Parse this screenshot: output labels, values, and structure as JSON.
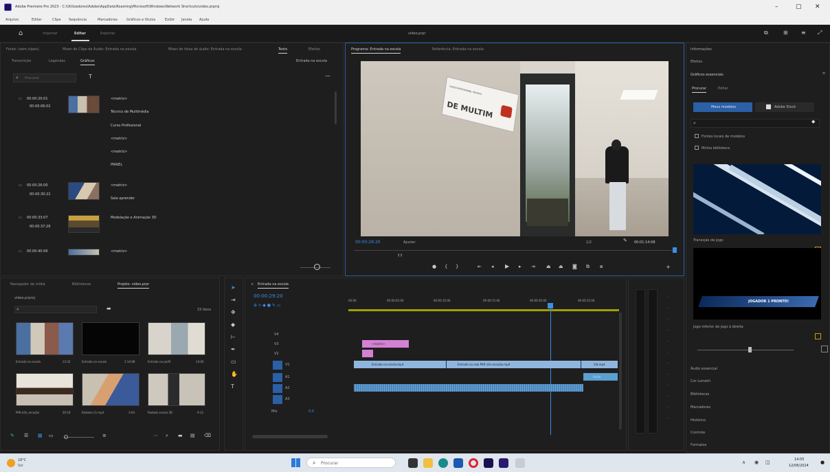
{
  "window": {
    "title": "Adobe Premiere Pro 2023 - C:\\Utilizadores\\Adobe\\AppData\\Roaming\\Microsoft\\Windows\\Network Shortcuts\\video.prproj",
    "controls": [
      "–",
      "▢",
      "✕"
    ]
  },
  "menu": [
    "Arquivo",
    "Editar",
    "Clipe",
    "Sequência",
    "Marcadores",
    "Gráficos e títulos",
    "Exibir",
    "Janela",
    "Ajuda"
  ],
  "header": {
    "tabs": [
      "Importar",
      "Editar",
      "Exportar"
    ],
    "active_tab": "Editar",
    "project_name": "video.prpr"
  },
  "source_panel": {
    "tabs": [
      "Fonte: (sem clipes)",
      "Mixer de Clipe de Áudio: Entrada na escola",
      "Mixer de faixa de áudio: Entrada na escola",
      "Texto",
      "Efeitos"
    ],
    "sub_tabs": [
      "Transcrição",
      "Legendas",
      "Gráficos"
    ],
    "active_sub_tab": "Gráficos",
    "search_placeholder": "Procurar",
    "sequence_label": "Entrada na escola",
    "items": [
      {
        "in": "00:00:20:01",
        "out": "00:00:06:02",
        "lines": [
          "<matriz>",
          "Técnico de Multimédia",
          "Curso Profissional",
          "<matriz>",
          "<matriz>",
          "PRAIEL"
        ]
      },
      {
        "in": "00:00:26:00",
        "out": "00:00:30:22",
        "lines": [
          "<matriz>",
          "Sala aprender"
        ]
      },
      {
        "in": "00:00:33:07",
        "out": "00:00:37:26",
        "lines": [
          "Modelação e Animação 3D"
        ]
      },
      {
        "in": "00:00:40:06",
        "out": "",
        "lines": [
          "<matriz>"
        ]
      }
    ]
  },
  "program_monitor": {
    "tabs": [
      "Programa: Entrada na escola",
      "Referência: Entrada na escola"
    ],
    "timecode": "00:00:29:20",
    "fit": "Ajustar",
    "quality": "1/2",
    "duration": "00:01:14:08",
    "sign_text": "DE MULTIM",
    "sign_small": "CURSO PROFISSIONAL TÉCNICO"
  },
  "right_panel": {
    "title": "Informações",
    "section1": "Efeitos",
    "section2": "Gráficos essenciais",
    "tabs": [
      "Procurar",
      "Editar"
    ],
    "active_tab": "Procurar",
    "buttons": [
      "Meus modelos",
      "Adobe Stock"
    ],
    "checkbox1": "Fontes locais de modelos",
    "checkbox2": "Minha biblioteca",
    "template1_label": "Transição de jogo",
    "template2_label": "Jogo inferior de jogo à direita",
    "template2_overlay": "JOGADOR 1 PRONTO!",
    "lower_items": [
      "Áudio essencial",
      "Cor Lumetri",
      "Bibliotecas",
      "Marcadores",
      "Histórico",
      "Controle",
      "Formatos"
    ]
  },
  "project_panel": {
    "tabs": [
      "Navegador de mídia",
      "Bibliotecas",
      "Projeto: video.prpr"
    ],
    "path": "video.prproj",
    "items_count": "15 itens",
    "thumbs": [
      {
        "name": "Entrada na escola",
        "dur": "13:32"
      },
      {
        "name": "Entrada na escola",
        "dur": "1:14:08"
      },
      {
        "name": "Entrada no perfil",
        "dur": "14:00"
      },
      {
        "name": "PAR.Info_receção",
        "dur": "20:16"
      },
      {
        "name": "Rodado (1).mp4",
        "dur": "3:04"
      },
      {
        "name": "Rodado escola 3D",
        "dur": "9:12"
      }
    ]
  },
  "timeline": {
    "tab": "Entrada na escola",
    "timecode": "00:00:29:20",
    "ruler": [
      "00:00",
      "00:00:05:00",
      "00:00:10:00",
      "00:00:15:00",
      "00:00:20:00",
      "00:00:25:00"
    ],
    "tracks": [
      "V4",
      "V3",
      "V2",
      "V1",
      "A1",
      "A2",
      "A3",
      "Mix"
    ],
    "clips": {
      "v3": "<matriz>",
      "v1_a": "Entrada na escola.mp4",
      "v1_b": "Entrada na sala PAR info receção.mp4",
      "v1_c": "Vid.mp4",
      "a1_b": "Audio"
    },
    "mix_value": "0.0"
  },
  "taskbar": {
    "weather_temp": "18°C",
    "weather_desc": "Sol",
    "search_placeholder": "Procurar",
    "time": "14:05",
    "date": "12/06/2024"
  }
}
